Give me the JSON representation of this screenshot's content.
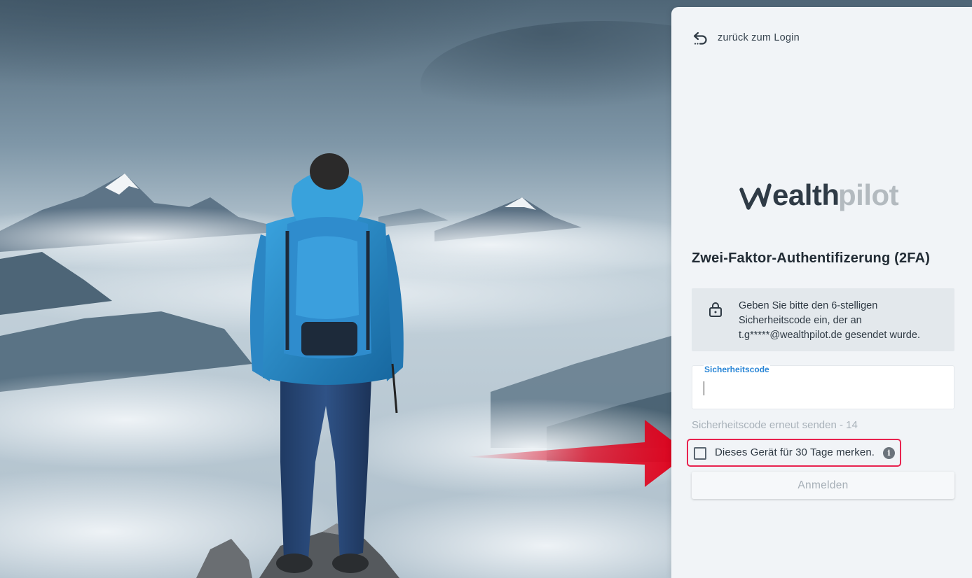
{
  "panel": {
    "back_link": {
      "label": "zurück zum Login",
      "icon": "undo-arrow-icon"
    },
    "logo": {
      "part1": "wealth",
      "part2": "pilot",
      "accent_color": "#2f3b46",
      "muted_color": "#b3babf"
    },
    "title": "Zwei-Faktor-Authentifizerung (2FA)",
    "info": {
      "icon": "lock-icon",
      "line1": "Geben Sie bitte den 6-stelligen",
      "line2": "Sicherheitscode ein, der an",
      "line3": "t.g*****@wealthpilot.de gesendet wurde."
    },
    "code_field": {
      "label": "Sicherheitscode",
      "value": ""
    },
    "resend_label": "Sicherheitscode erneut senden - 14",
    "remember": {
      "label": "Dieses Gerät für 30 Tage merken.",
      "checked": false,
      "info_icon": "info-icon",
      "highlight_color": "#e8234f"
    },
    "submit_label": "Anmelden"
  },
  "annotation": {
    "icon": "red-arrow-icon",
    "color": "#e0001b"
  },
  "background": {
    "description_icon": "mountain-hiker-photo"
  }
}
